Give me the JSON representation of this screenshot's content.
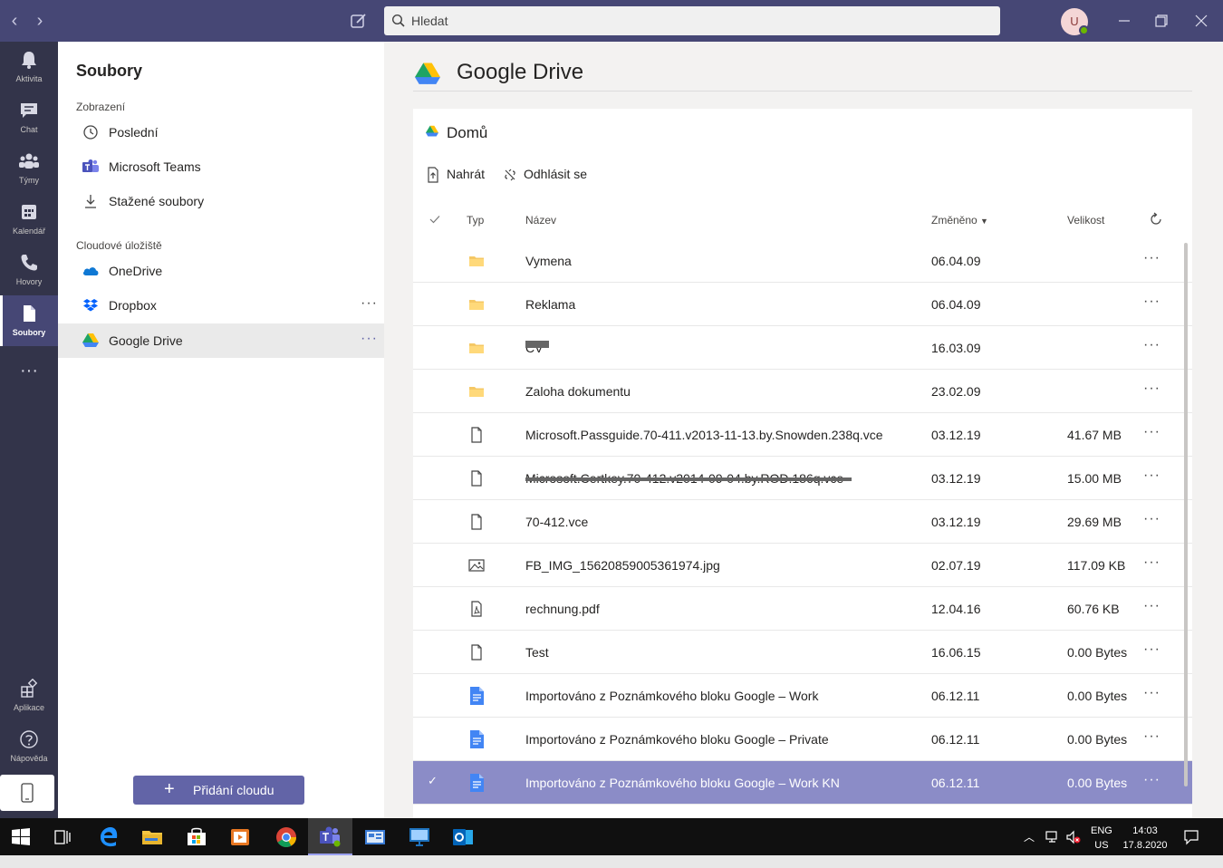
{
  "titlebar": {
    "search_placeholder": "Hledat",
    "avatar_initial": "U",
    "accent": "#464775"
  },
  "rail": {
    "items": [
      {
        "label": "Aktivita",
        "icon": "bell-icon"
      },
      {
        "label": "Chat",
        "icon": "chat-icon"
      },
      {
        "label": "Týmy",
        "icon": "teams-icon"
      },
      {
        "label": "Kalendář",
        "icon": "calendar-icon"
      },
      {
        "label": "Hovory",
        "icon": "phone-icon"
      },
      {
        "label": "Soubory",
        "icon": "file-icon",
        "active": true
      }
    ],
    "more": "···",
    "bottom": [
      {
        "label": "Aplikace",
        "icon": "apps-icon"
      },
      {
        "label": "Nápověda",
        "icon": "help-icon"
      }
    ]
  },
  "files_panel": {
    "title": "Soubory",
    "view_section": "Zobrazení",
    "view_items": [
      {
        "label": "Poslední",
        "icon": "clock-icon"
      },
      {
        "label": "Microsoft Teams",
        "icon": "teams-logo-icon"
      },
      {
        "label": "Stažené soubory",
        "icon": "download-icon"
      }
    ],
    "cloud_section": "Cloudové úložiště",
    "cloud_items": [
      {
        "label": "OneDrive",
        "icon": "onedrive-icon"
      },
      {
        "label": "Dropbox",
        "icon": "dropbox-icon",
        "more": "···"
      },
      {
        "label": "Google Drive",
        "icon": "google-drive-icon",
        "more": "···",
        "selected": true
      }
    ],
    "add_cloud_label": "Přidání cloudu"
  },
  "main": {
    "title": "Google Drive",
    "breadcrumb": "Domů",
    "toolbar": {
      "upload": "Nahrát",
      "signout": "Odhlásit se"
    },
    "columns": {
      "type": "Typ",
      "name": "Název",
      "modified": "Změněno",
      "size": "Velikost"
    },
    "rows": [
      {
        "type": "folder",
        "name": "Vymena",
        "date": "06.04.09",
        "size": "",
        "more": "···"
      },
      {
        "type": "folder",
        "name": "Reklama",
        "date": "06.04.09",
        "size": "",
        "more": "···"
      },
      {
        "type": "folder",
        "name": "CV",
        "date": "16.03.09",
        "size": "",
        "more": "···",
        "redacted": true
      },
      {
        "type": "folder",
        "name": "Zaloha dokumentu",
        "date": "23.02.09",
        "size": "",
        "more": "···"
      },
      {
        "type": "file",
        "name": "Microsoft.Passguide.70-411.v2013-11-13.by.Snowden.238q.vce",
        "date": "03.12.19",
        "size": "41.67 MB",
        "more": "···"
      },
      {
        "type": "file",
        "name": "Microsoft.Certkey.70-412.v2014-09-04.by.ROD.186q.vce",
        "date": "03.12.19",
        "size": "15.00 MB",
        "more": "···",
        "redacted": true
      },
      {
        "type": "file",
        "name": "70-412.vce",
        "date": "03.12.19",
        "size": "29.69 MB",
        "more": "···"
      },
      {
        "type": "image",
        "name": "FB_IMG_15620859005361974.jpg",
        "date": "02.07.19",
        "size": "117.09 KB",
        "more": "···"
      },
      {
        "type": "pdf",
        "name": "rechnung.pdf",
        "date": "12.04.16",
        "size": "60.76 KB",
        "more": "···"
      },
      {
        "type": "file",
        "name": "Test",
        "date": "16.06.15",
        "size": "0.00 Bytes",
        "more": "···"
      },
      {
        "type": "gdoc",
        "name": "Importováno z Poznámkového bloku Google – Work",
        "date": "06.12.11",
        "size": "0.00 Bytes",
        "more": "···"
      },
      {
        "type": "gdoc",
        "name": "Importováno z Poznámkového bloku Google – Private",
        "date": "06.12.11",
        "size": "0.00 Bytes",
        "more": "···"
      },
      {
        "type": "gdoc",
        "name": "Importováno z Poznámkového bloku Google – Work KN",
        "date": "06.12.11",
        "size": "0.00 Bytes",
        "more": "···",
        "selected": true
      }
    ],
    "selected_color": "#8b8cc7"
  },
  "taskbar": {
    "lang_top": "ENG",
    "lang_bottom": "US",
    "time": "14:03",
    "date": "17.8.2020"
  }
}
